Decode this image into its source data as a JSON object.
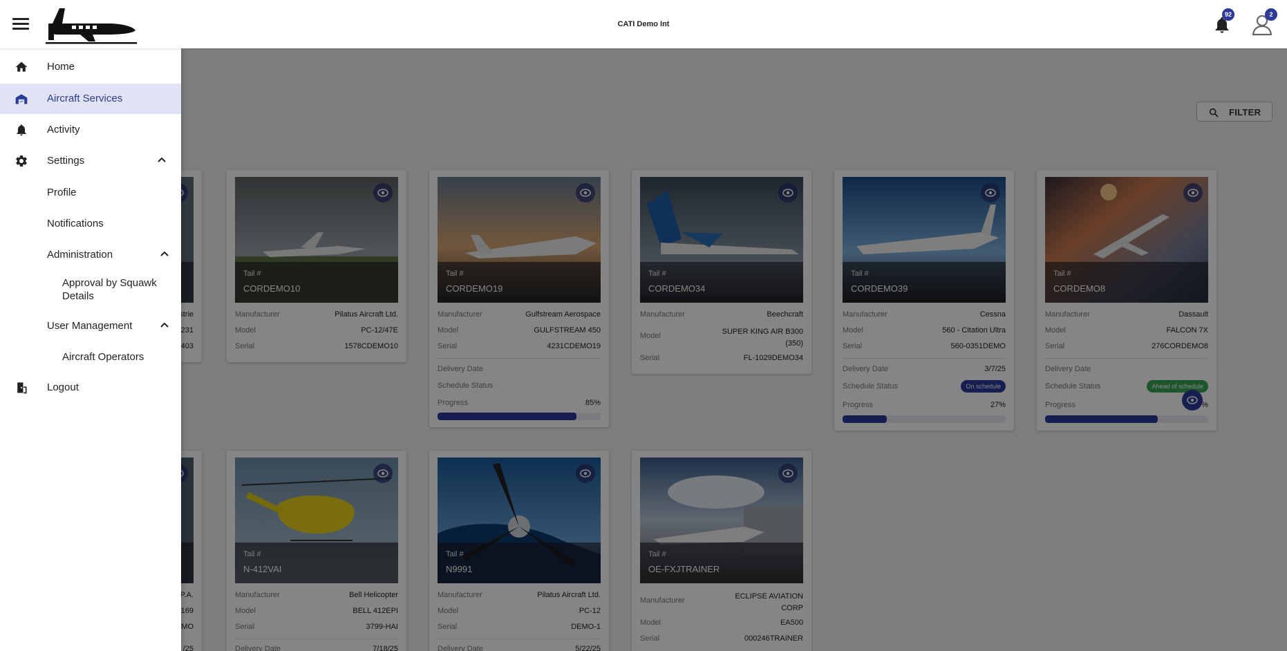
{
  "header": {
    "app_title": "CATI Demo Int",
    "notifications_count": "92",
    "user_badge": "2"
  },
  "toolbar": {
    "filter_label": "FILTER"
  },
  "nav": {
    "home": "Home",
    "aircraft_services": "Aircraft Services",
    "activity": "Activity",
    "settings": "Settings",
    "profile": "Profile",
    "notifications": "Notifications",
    "administration": "Administration",
    "approval_by_squawk": "Approval by Squawk Details",
    "user_management": "User Management",
    "aircraft_operators": "Aircraft Operators",
    "logout": "Logout"
  },
  "labels": {
    "tail": "Tail #",
    "manufacturer": "Manufacturer",
    "model": "Model",
    "serial": "Serial",
    "delivery_date": "Delivery Date",
    "schedule_status": "Schedule Status",
    "progress": "Progress"
  },
  "partial_cards": {
    "row1": {
      "manufacturer": "strie",
      "model": "-231",
      "serial": "403"
    },
    "row2": {
      "manufacturer": ".P.A.",
      "model": "169",
      "serial": "EMO",
      "delivery": "/25"
    }
  },
  "aircraft": [
    {
      "tail": "CORDEMO10",
      "manufacturer": "Pilatus Aircraft Ltd.",
      "model": "PC-12/47E",
      "serial": "1578CDEMO10"
    },
    {
      "tail": "CORDEMO19",
      "manufacturer": "Gulfstream Aerospace",
      "model": "GULFSTREAM 450",
      "serial": "4231CDEMO19",
      "delivery_date": "",
      "schedule_status": "",
      "progress": "85%",
      "progress_value": 85
    },
    {
      "tail": "CORDEMO34",
      "manufacturer": "Beechcraft",
      "model": "SUPER KING AIR B300 (350)",
      "serial": "FL-1029DEMO34"
    },
    {
      "tail": "CORDEMO39",
      "manufacturer": "Cessna",
      "model": "560 - Citation Ultra",
      "serial": "560-0351DEMO",
      "delivery_date": "3/7/25",
      "schedule_status": "On schedule",
      "status_color": "#2c3a9a",
      "progress": "27%",
      "progress_value": 27
    },
    {
      "tail": "CORDEMO8",
      "manufacturer": "Dassault",
      "model": "FALCON 7X",
      "serial": "276CORDEMO8",
      "delivery_date": "",
      "schedule_status": "Ahead of schedule",
      "status_color": "#3aa655",
      "progress": "%",
      "progress_value": 69
    },
    {
      "tail": "N-412VAI",
      "manufacturer": "Bell Helicopter",
      "model": "BELL 412EPI",
      "serial": "3799-HAI",
      "delivery_date": "7/18/25"
    },
    {
      "tail": "N9991",
      "manufacturer": "Pilatus Aircraft Ltd.",
      "model": "PC-12",
      "serial": "DEMO-1",
      "delivery_date": "5/22/25"
    },
    {
      "tail": "OE-FXJTRAINER",
      "manufacturer": "ECLIPSE AVIATION CORP",
      "model": "EA500",
      "serial": "000246TRAINER"
    }
  ]
}
